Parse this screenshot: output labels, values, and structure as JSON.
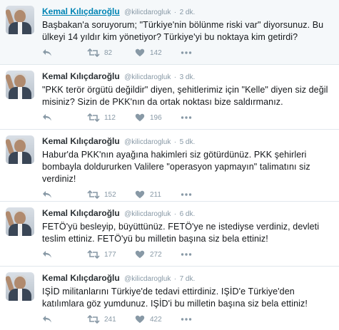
{
  "icons": {
    "reply": "reply-icon",
    "retweet": "retweet-icon",
    "like": "heart-icon",
    "more": "more-icon"
  },
  "colors": {
    "name_link": "#0084b4",
    "meta_gray": "#8899a6",
    "highlight_bg": "#f5f8fa"
  },
  "tweets": [
    {
      "name": "Kemal Kılıçdaroğlu",
      "handle": "@kilicdarogluk",
      "separator": "·",
      "time": "2 dk.",
      "text": "Başbakan'a soruyorum; \"Türkiye'nin bölünme riski var\" diyorsunuz. Bu ülkeyi 14 yıldır kim yönetiyor? Türkiye'yi bu noktaya kim getirdi?",
      "retweets": "82",
      "likes": "142"
    },
    {
      "name": "Kemal Kılıçdaroğlu",
      "handle": "@kilicdarogluk",
      "separator": "·",
      "time": "3 dk.",
      "text": "\"PKK terör örgütü değildir\" diyen, şehitlerimiz için \"Kelle\" diyen siz değil misiniz? Sizin de PKK'nın da ortak noktası bize saldırmanız.",
      "retweets": "112",
      "likes": "196"
    },
    {
      "name": "Kemal Kılıçdaroğlu",
      "handle": "@kilicdarogluk",
      "separator": "·",
      "time": "5 dk.",
      "text": "Habur'da PKK'nın ayağına hakimleri siz götürdünüz. PKK şehirleri bombayla doldururken Valilere \"operasyon yapmayın\" talimatını siz verdiniz!",
      "retweets": "152",
      "likes": "211"
    },
    {
      "name": "Kemal Kılıçdaroğlu",
      "handle": "@kilicdarogluk",
      "separator": "·",
      "time": "6 dk.",
      "text": "FETÖ'yü besleyip, büyüttünüz. FETÖ'ye ne istediyse verdiniz, devleti teslim ettiniz. FETÖ'yü bu milletin başına siz bela ettiniz!",
      "retweets": "177",
      "likes": "272"
    },
    {
      "name": "Kemal Kılıçdaroğlu",
      "handle": "@kilicdarogluk",
      "separator": "·",
      "time": "7 dk.",
      "text": "IŞİD militanlarını Türkiye'de tedavi ettirdiniz. IŞİD'e Türkiye'den katılımlara göz yumdunuz. IŞİD'i bu milletin başına siz bela ettiniz!",
      "retweets": "241",
      "likes": "422"
    }
  ]
}
